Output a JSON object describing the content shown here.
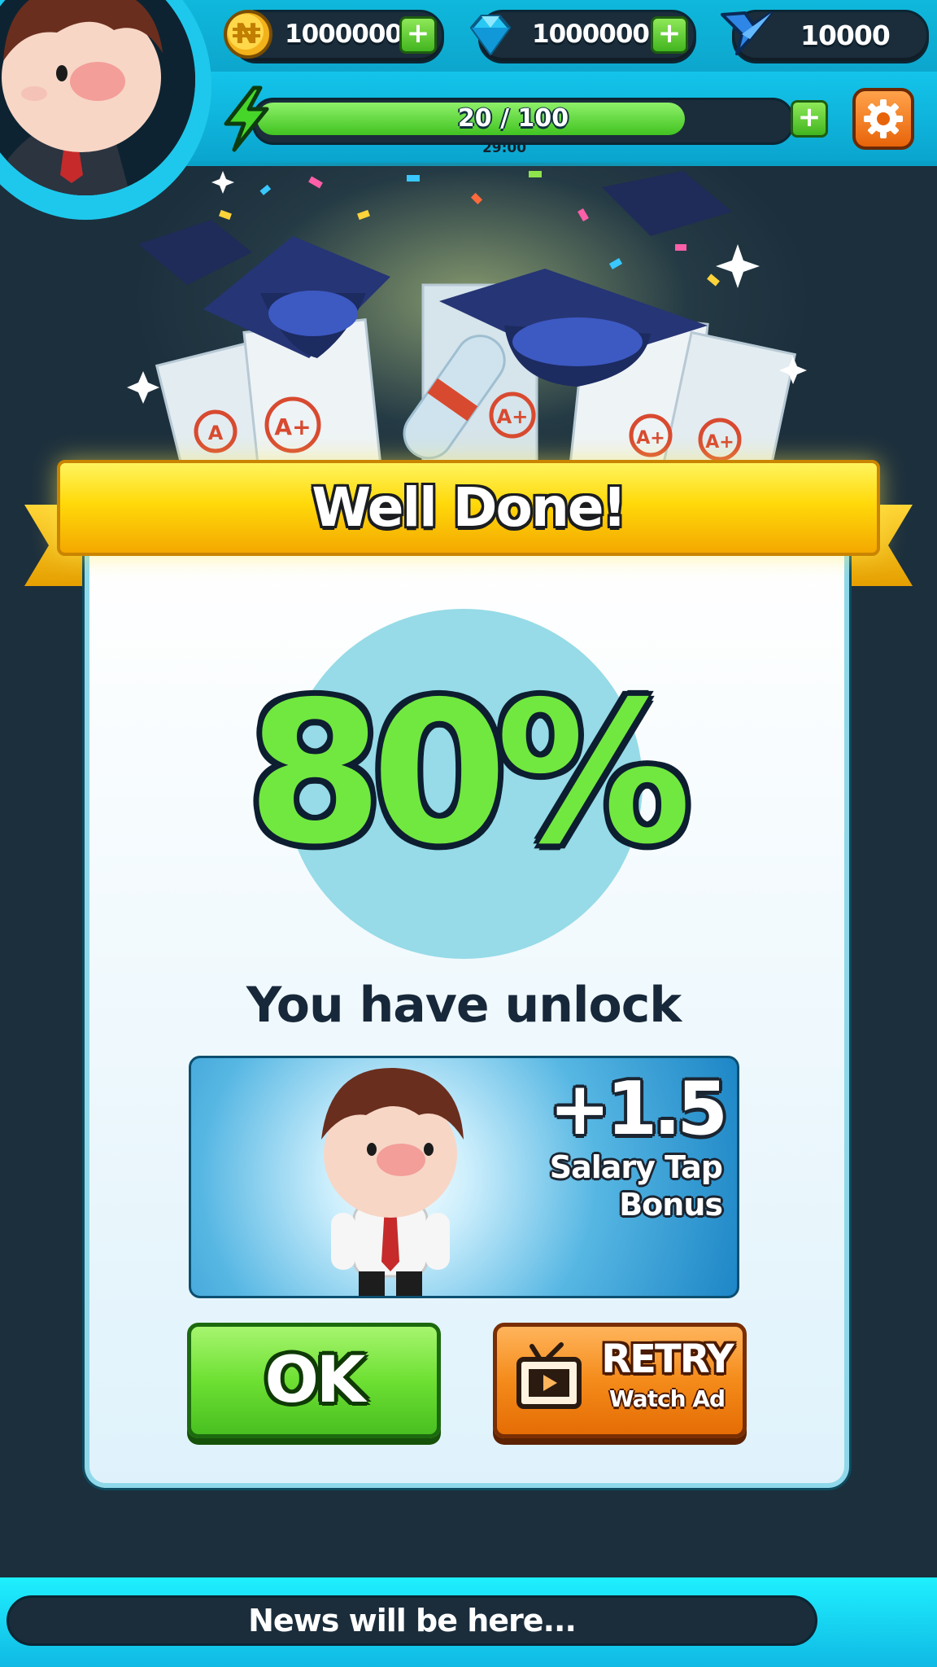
{
  "hud": {
    "currency_naira": "1000000",
    "currency_gems": "1000000",
    "currency_wings": "10000",
    "energy_text": "20 / 100",
    "energy_fraction": 0.2,
    "energy_timer": "29:00"
  },
  "result": {
    "banner_title": "Well Done!",
    "score": "80%",
    "unlock_text": "You have unlock",
    "bonus_value": "+1.5",
    "bonus_label_line1": "Salary Tap",
    "bonus_label_line2": "Bonus"
  },
  "buttons": {
    "ok_label": "OK",
    "retry_label": "RETRY",
    "retry_sub_label": "Watch Ad"
  },
  "news": {
    "text": "News will be here..."
  },
  "icons": {
    "currency_naira": "naira-coin-icon",
    "currency_gems": "diamond-icon",
    "currency_wings": "wings-icon",
    "energy": "lightning-icon",
    "settings": "gear-icon",
    "retry": "tv-play-icon"
  },
  "colors": {
    "hud_blue": "#0fb8dc",
    "banner_yellow": "#ffd90a",
    "score_green": "#71e83f",
    "ok_green": "#6ee033",
    "retry_orange": "#f48b1a",
    "dark_navy": "#1c2f3d"
  }
}
